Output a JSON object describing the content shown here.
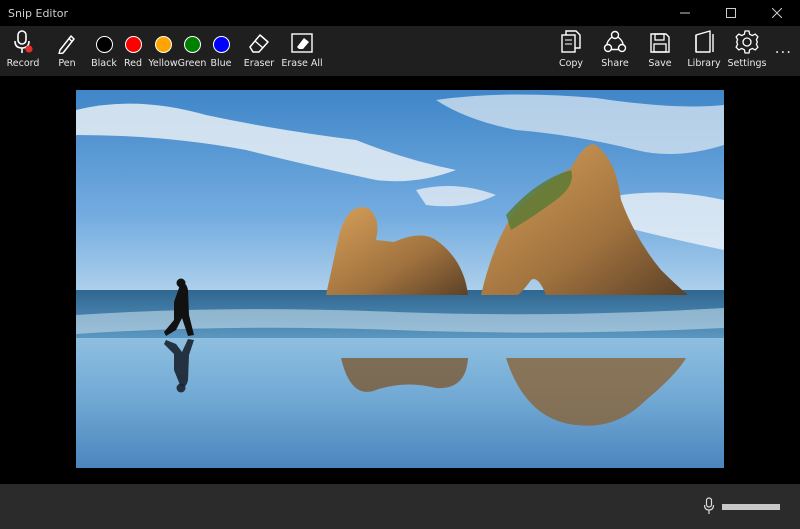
{
  "window": {
    "title": "Snip Editor",
    "controls": [
      "minimize",
      "maximize",
      "close"
    ]
  },
  "toolbar": {
    "record_label": "Record",
    "pen_label": "Pen",
    "colors": [
      {
        "label": "Black",
        "hex": "#000000"
      },
      {
        "label": "Red",
        "hex": "#ff0000"
      },
      {
        "label": "Yellow",
        "hex": "#ffa500"
      },
      {
        "label": "Green",
        "hex": "#008000"
      },
      {
        "label": "Blue",
        "hex": "#0000ff"
      }
    ],
    "eraser_label": "Eraser",
    "erase_all_label": "Erase All",
    "copy_label": "Copy",
    "share_label": "Share",
    "save_label": "Save",
    "library_label": "Library",
    "settings_label": "Settings",
    "more_label": "..."
  },
  "status": {
    "volume_fraction": 1.0
  },
  "icons": {
    "record": "microphone-icon",
    "pen": "pen-icon",
    "eraser": "eraser-icon",
    "erase_all": "erase-all-icon",
    "copy": "copy-icon",
    "share": "share-icon",
    "save": "floppy-icon",
    "library": "books-icon",
    "settings": "gear-icon"
  },
  "colors": {
    "toolbar_bg": "#1f1f1f",
    "record_dot": "#e0302a",
    "statusbar_bg": "#2b2b2b"
  }
}
